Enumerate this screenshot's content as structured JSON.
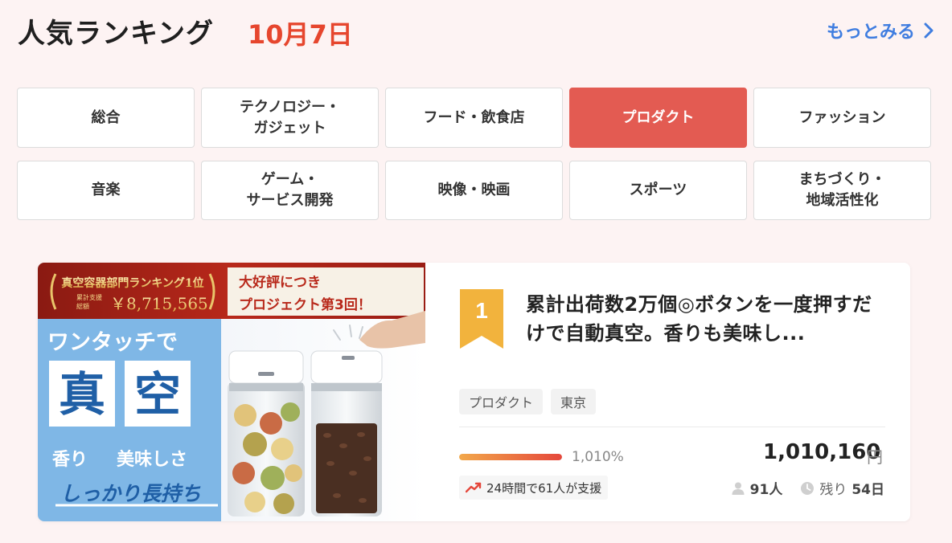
{
  "header": {
    "title": "人気ランキング",
    "date": "10月7日",
    "more_label": "もっとみる"
  },
  "categories": [
    {
      "label": "総合",
      "active": false
    },
    {
      "label": "テクノロジー・\nガジェット",
      "active": false
    },
    {
      "label": "フード・飲食店",
      "active": false
    },
    {
      "label": "プロダクト",
      "active": true
    },
    {
      "label": "ファッション",
      "active": false
    },
    {
      "label": "音楽",
      "active": false
    },
    {
      "label": "ゲーム・\nサービス開発",
      "active": false
    },
    {
      "label": "映像・映画",
      "active": false
    },
    {
      "label": "スポーツ",
      "active": false
    },
    {
      "label": "まちづくり・\n地域活性化",
      "active": false
    }
  ],
  "card": {
    "rank": "1",
    "title": "累計出荷数2万個◎ボタンを一度押すだけで自動真空。香りも美味し...",
    "tags": [
      "プロダクト",
      "東京"
    ],
    "progress_pct": 100,
    "percent_label": "1,010%",
    "amount": "1,010,160",
    "currency": "円",
    "trend_text": "24時間で61人が支援",
    "supporters": "91人",
    "remaining_prefix": "残り",
    "remaining_days": "54日",
    "image": {
      "banner_line1": "真空容器部門ランキング1位",
      "banner_line2_small": "累計支援\n総額",
      "banner_amount": "￥8,715,565",
      "banner_right_top": "大好評につき",
      "banner_right_bottom": "プロジェクト第3回！",
      "ad_line1": "ワンタッチで",
      "ad_big1": "真",
      "ad_big2": "空",
      "ad_feature1": "香り",
      "ad_feature2": "美味しさ",
      "ad_tagline": "しっかり長持ち"
    },
    "colors": {
      "rank_badge": "#f2b33d",
      "accent": "#e35b52",
      "bar_start": "#f2a84a",
      "bar_end": "#e5473b"
    }
  }
}
